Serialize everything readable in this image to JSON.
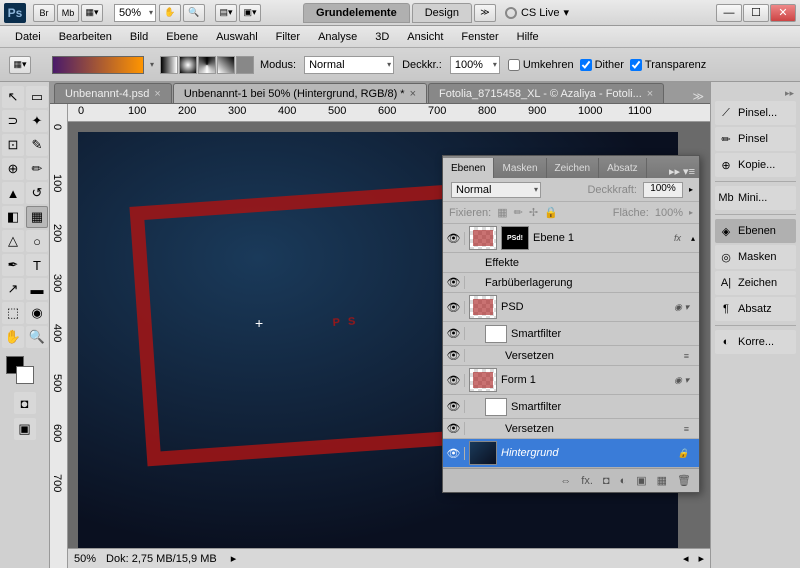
{
  "titlebar": {
    "zoom": "50%",
    "workspace_active": "Grundelemente",
    "workspace_2": "Design",
    "cslive": "CS Live"
  },
  "menu": [
    "Datei",
    "Bearbeiten",
    "Bild",
    "Ebene",
    "Auswahl",
    "Filter",
    "Analyse",
    "3D",
    "Ansicht",
    "Fenster",
    "Hilfe"
  ],
  "options": {
    "modus_label": "Modus:",
    "modus_value": "Normal",
    "deckkraft_label": "Deckkr.:",
    "deckkraft_value": "100%",
    "umkehren": "Umkehren",
    "dither": "Dither",
    "transparenz": "Transparenz"
  },
  "tabs": [
    {
      "label": "Unbenannt-4.psd",
      "active": false
    },
    {
      "label": "Unbenannt-1 bei 50% (Hintergrund, RGB/8) *",
      "active": true
    },
    {
      "label": "Fotolia_8715458_XL - © Azaliya - Fotoli...",
      "active": false
    }
  ],
  "ruler_h": [
    "0",
    "100",
    "200",
    "300",
    "400",
    "500",
    "600",
    "700",
    "800",
    "900",
    "1000",
    "1100"
  ],
  "ruler_v": [
    "0",
    "100",
    "200",
    "300",
    "400",
    "500",
    "600",
    "700"
  ],
  "stamp_text": "PS",
  "status": {
    "zoom": "50%",
    "doc": "Dok: 2,75 MB/15,9 MB"
  },
  "dock": {
    "pinsel1": "Pinsel...",
    "pinsel2": "Pinsel",
    "kopie": "Kopie...",
    "mini": "Mini...",
    "ebenen": "Ebenen",
    "masken": "Masken",
    "zeichen": "Zeichen",
    "absatz": "Absatz",
    "korre": "Korre..."
  },
  "panel": {
    "tabs": [
      "Ebenen",
      "Masken",
      "Zeichen",
      "Absatz"
    ],
    "blend": "Normal",
    "deckkraft_label": "Deckkraft:",
    "deckkraft": "100%",
    "fixieren": "Fixieren:",
    "flaeche_label": "Fläche:",
    "flaeche": "100%",
    "layers": {
      "ebene1": "Ebene 1",
      "effekte": "Effekte",
      "farbueberlagerung": "Farbüberlagerung",
      "psd": "PSD",
      "smartfilter": "Smartfilter",
      "versetzen": "Versetzen",
      "form1": "Form 1",
      "hintergrund": "Hintergrund"
    },
    "fx": "fx"
  }
}
